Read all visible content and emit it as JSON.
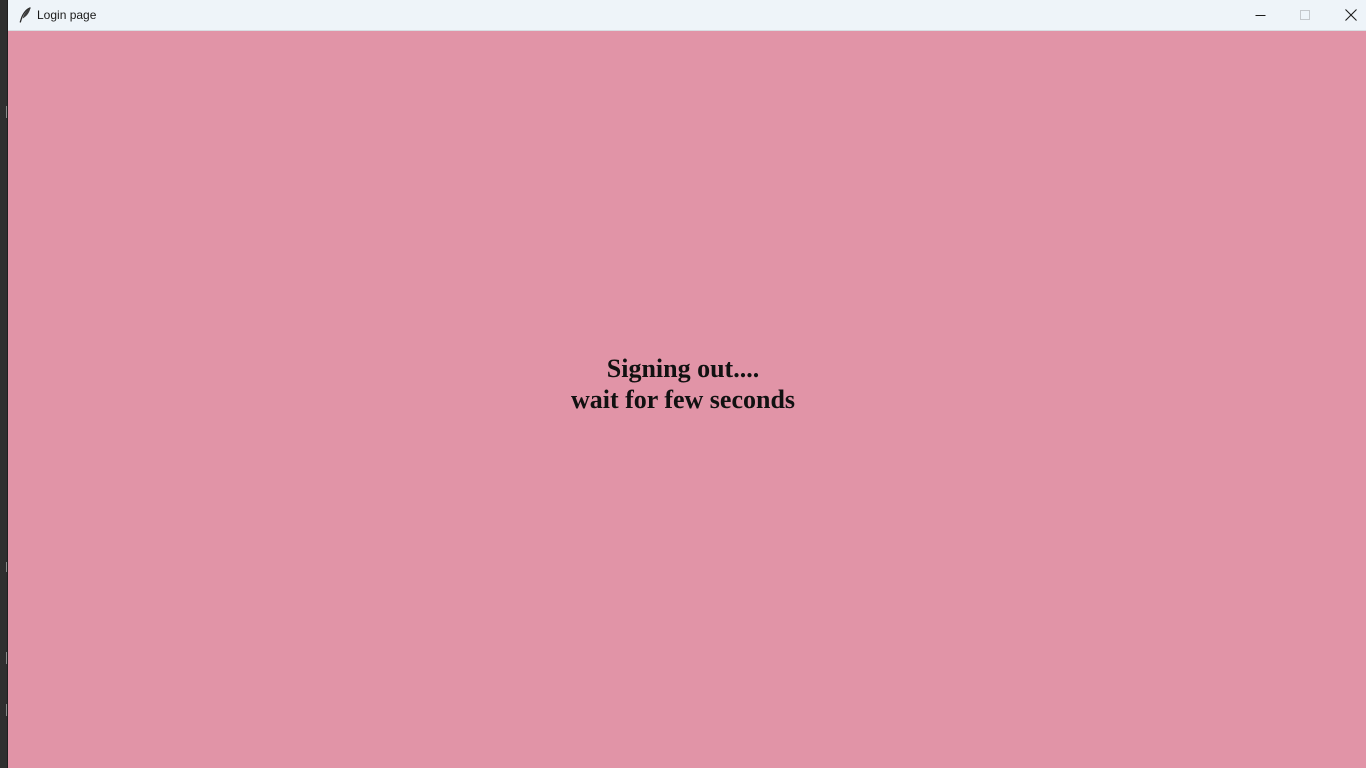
{
  "window": {
    "title": "Login page",
    "app_icon": "feather-icon",
    "controls": {
      "minimize_icon": "minimize-icon",
      "maximize_icon": "maximize-icon",
      "close_icon": "close-icon"
    }
  },
  "content": {
    "background_color": "#e194a7",
    "message_line1": "Signing out....",
    "message_line2": "wait for few seconds"
  }
}
